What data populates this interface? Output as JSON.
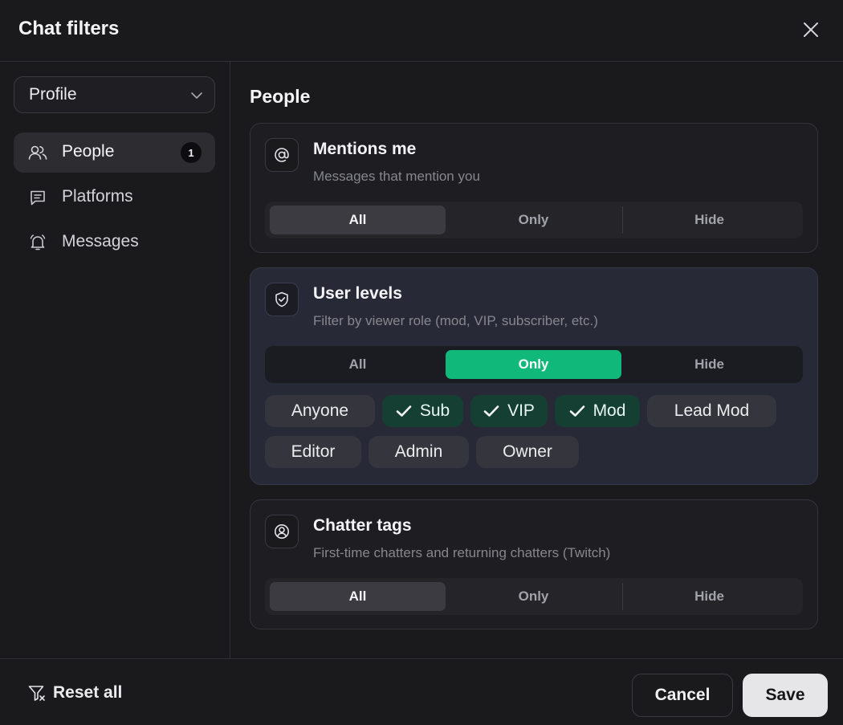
{
  "dialog": {
    "title": "Chat filters"
  },
  "sidebar": {
    "profile_select": {
      "value": "Profile"
    },
    "items": [
      {
        "label": "People",
        "badge": "1",
        "icon": "people-icon",
        "active": true
      },
      {
        "label": "Platforms",
        "icon": "message-square-icon",
        "active": false
      },
      {
        "label": "Messages",
        "icon": "bell-icon",
        "active": false
      }
    ]
  },
  "main": {
    "section_title": "People",
    "segment_labels": [
      "All",
      "Only",
      "Hide"
    ],
    "cards": [
      {
        "title": "Mentions me",
        "description": "Messages that mention you",
        "icon": "at-sign-icon",
        "selected": "All"
      },
      {
        "title": "User levels",
        "description": "Filter by viewer role (mod, VIP, subscriber, etc.)",
        "icon": "shield-check-icon",
        "selected": "Only",
        "chips": [
          {
            "label": "Anyone",
            "checked": false
          },
          {
            "label": "Sub",
            "checked": true
          },
          {
            "label": "VIP",
            "checked": true
          },
          {
            "label": "Mod",
            "checked": true
          },
          {
            "label": "Lead Mod",
            "checked": false
          },
          {
            "label": "Editor",
            "checked": false
          },
          {
            "label": "Admin",
            "checked": false
          },
          {
            "label": "Owner",
            "checked": false
          }
        ]
      },
      {
        "title": "Chatter tags",
        "description": "First-time chatters and returning chatters (Twitch)",
        "icon": "user-circle-icon",
        "selected": "All"
      }
    ]
  },
  "footer": {
    "reset_label": "Reset all",
    "cancel_label": "Cancel",
    "save_label": "Save"
  },
  "colors": {
    "accent": "#10b97a",
    "chip_checked": "#153f33",
    "background": "#1a1a1d",
    "highlight_card": "#272a36"
  }
}
